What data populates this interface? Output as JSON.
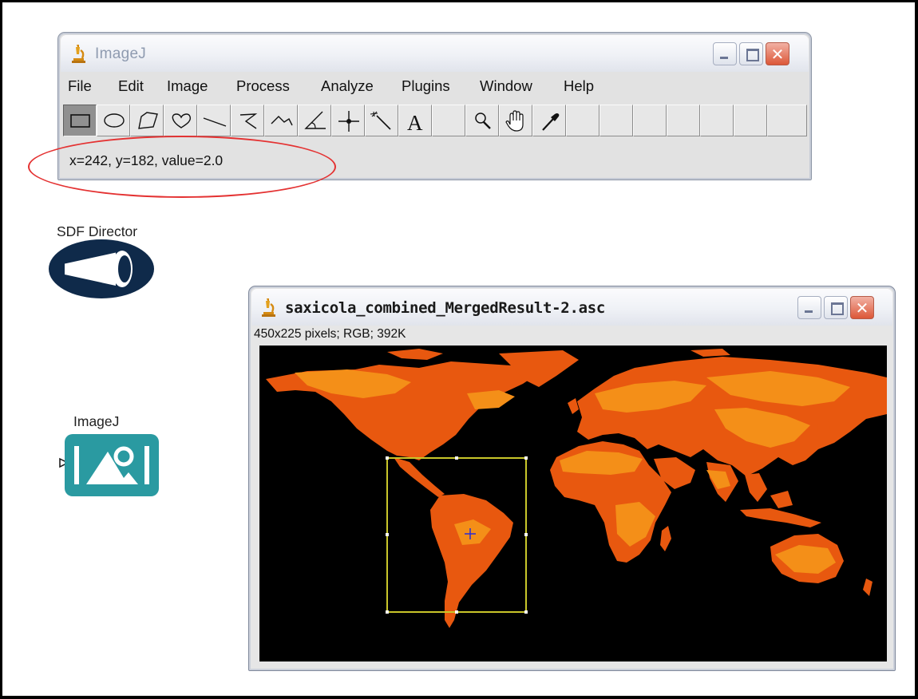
{
  "imagej_window": {
    "title": "ImageJ",
    "icon": "microscope-icon",
    "controls": {
      "minimize": "minimize-icon",
      "maximize": "maximize-icon",
      "close": "close-icon",
      "close_glyph": "✕"
    },
    "menu": [
      "File",
      "Edit",
      "Image",
      "Process",
      "Analyze",
      "Plugins",
      "Window",
      "Help"
    ],
    "tools": [
      {
        "name": "rectangle-tool",
        "icon": "rectangle-icon",
        "selected": true
      },
      {
        "name": "oval-tool",
        "icon": "oval-icon"
      },
      {
        "name": "polygon-tool",
        "icon": "polygon-icon"
      },
      {
        "name": "freehand-tool",
        "icon": "freehand-icon"
      },
      {
        "name": "straight-line-tool",
        "icon": "line-icon"
      },
      {
        "name": "segmented-line-tool",
        "icon": "segmented-line-icon"
      },
      {
        "name": "freehand-line-tool",
        "icon": "freehand-line-icon"
      },
      {
        "name": "angle-tool",
        "icon": "angle-icon"
      },
      {
        "name": "point-tool",
        "icon": "crosshair-icon"
      },
      {
        "name": "wand-tool",
        "icon": "wand-icon"
      },
      {
        "name": "text-tool",
        "icon": "text-icon",
        "glyph": "A"
      },
      {
        "name": "empty-slot",
        "icon": ""
      },
      {
        "name": "magnifier-tool",
        "icon": "magnifier-icon"
      },
      {
        "name": "scrolling-tool",
        "icon": "hand-icon"
      },
      {
        "name": "color-picker-tool",
        "icon": "eyedropper-icon"
      },
      {
        "name": "empty-slot",
        "icon": ""
      },
      {
        "name": "empty-slot",
        "icon": ""
      },
      {
        "name": "empty-slot",
        "icon": ""
      },
      {
        "name": "empty-slot",
        "icon": ""
      },
      {
        "name": "empty-slot",
        "icon": ""
      },
      {
        "name": "empty-slot",
        "icon": ""
      },
      {
        "name": "empty-slot",
        "icon": ""
      }
    ],
    "status": "x=242, y=182, value=2.0"
  },
  "annotation": {
    "highlight_color": "#e43232"
  },
  "actors": {
    "sdf_director": {
      "label": "SDF Director",
      "icon": "megaphone-icon",
      "color": "#0f2a4a"
    },
    "imagej_actor": {
      "label": "ImageJ",
      "icon": "image-viewer-icon",
      "color": "#2a9aa1",
      "port_icon": "input-port-icon"
    }
  },
  "image_window": {
    "title": "saxicola_combined_MergedResult-2.asc",
    "icon": "microscope-icon",
    "controls": {
      "minimize": "minimize-icon",
      "maximize": "maximize-icon",
      "close": "close-icon",
      "close_glyph": "✕"
    },
    "info": "450x225 pixels; RGB; 392K",
    "map": {
      "background": "#000000",
      "land_color": "#e8580f",
      "highlight_color": "#f48f18",
      "selection_color": "#c9c62a",
      "cursor_color": "#2a2ad6"
    }
  }
}
